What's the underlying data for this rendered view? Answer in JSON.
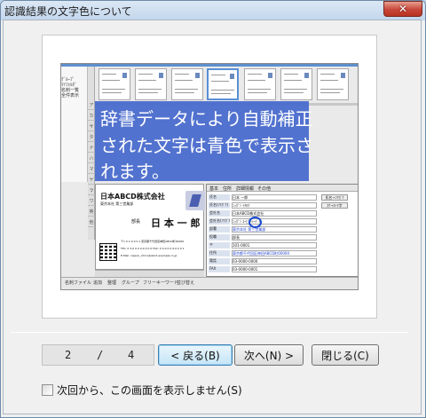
{
  "window": {
    "title": "認識結果の文字色について",
    "close_glyph": "✕"
  },
  "tutorial_image": {
    "overlay_lines": [
      "辞書データにより自動補正",
      "された文字は青色で表示さ",
      "れます。"
    ],
    "tree_items": [
      "ｸﾞﾙｰﾌﾟ",
      "ﾏｲﾌｫﾙﾀﾞ",
      "名刺一覧",
      "全件表示"
    ],
    "toolbar_cells": [
      "ア",
      "カ",
      "サ",
      "タ",
      "ナ",
      "ハ",
      "マ",
      "ヤ",
      "ラ",
      "ワ",
      "英",
      "他"
    ],
    "card": {
      "company": "日本ABCD株式会社",
      "department": "東京本社 第三営業部",
      "title_label": "部長",
      "name": "日 本  一 郎",
      "address": "〒1 0 1-0 0 0 1 東京都千代田区神田ABCD町00000",
      "phone": "TEL: 0 3-0 0 0 0-0 0 0 0 FAX: 0 3-0 0 0 0-0 0 0 1",
      "email": "E-Mail: nippon_ichiro@abcd-example.co.jp"
    },
    "form_tabs": [
      "基本",
      "住所",
      "詳細情報",
      "その他"
    ],
    "form_rows": [
      {
        "label": "氏名",
        "value": "日本 一郎",
        "blue": false
      },
      {
        "label": "氏名(ﾌﾘｶﾞﾅ)",
        "value": "ﾆｯﾎﾟﾝ ｲﾁﾛｳ",
        "blue": false
      },
      {
        "label": "会社名",
        "value": "日本ABCD株式会社",
        "blue": false
      },
      {
        "label": "会社名(ﾌﾘｶﾞﾅ)",
        "value": "ﾆｯﾎﾟﾝ ｴｰﾋﾞｰｼｰﾃﾞｨｰ",
        "blue": false
      },
      {
        "label": "部署",
        "value": "東京本社 第三営業部",
        "blue": true
      },
      {
        "label": "役職",
        "value": "部長",
        "blue": false
      },
      {
        "label": "〒",
        "value": "101-0001",
        "blue": false
      },
      {
        "label": "住所",
        "value": "東京都千代田区神田ABCD町00000",
        "blue": true
      },
      {
        "label": "電話",
        "value": "03-0000-0000",
        "blue": false
      },
      {
        "label": "FAX",
        "value": "03-0000-0001",
        "blue": false
      }
    ],
    "form_buttons": [
      "氏名→ﾌﾘｶﾞﾅ",
      "ｶﾅ→ﾛｰﾏ字"
    ],
    "status_items": [
      "名刺ファイル",
      "追加",
      "整理",
      "グループ",
      "フリーキーワード",
      "並び替え"
    ]
  },
  "navigation": {
    "page_current": "2",
    "page_sep": "/",
    "page_total": "4",
    "back_label": "< 戻る(B)",
    "next_label": "次へ(N) >",
    "close_label": "閉じる(C)"
  },
  "footer": {
    "dont_show_label": "次回から、この画面を表示しません(S)"
  }
}
